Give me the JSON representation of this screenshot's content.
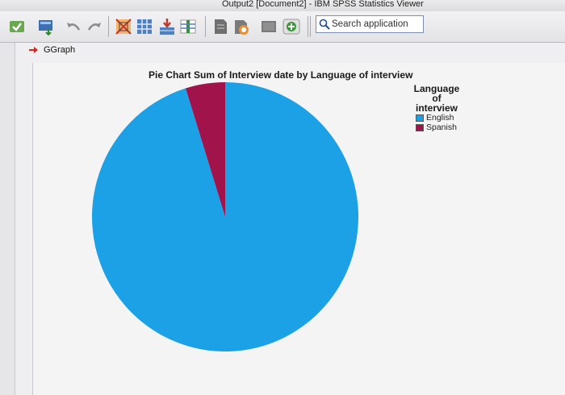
{
  "window": {
    "title": "Output2 [Document2] - IBM SPSS Statistics Viewer"
  },
  "toolbar": {
    "search_placeholder": "Search application",
    "icons": [
      "open-icon",
      "export-icon",
      "undo-icon",
      "redo-icon",
      "pivot-icon",
      "data-icon",
      "insert-case-icon",
      "variables-icon",
      "output-icon",
      "designated-window-icon",
      "edit-icon",
      "add-icon"
    ]
  },
  "outline": {
    "node_label": "GGraph"
  },
  "colors": {
    "english": "#1ca0e6",
    "spanish": "#a0134b",
    "arrow": "#d3281f"
  },
  "chart_data": {
    "type": "pie",
    "title": "Pie Chart Sum of Interview date by Language of interview",
    "legend_title": "Language of interview",
    "legend_position": "top-right",
    "categories": [
      "English",
      "Spanish"
    ],
    "values": [
      95.2,
      4.8
    ],
    "colors": [
      "#1ca0e6",
      "#a0134b"
    ]
  }
}
